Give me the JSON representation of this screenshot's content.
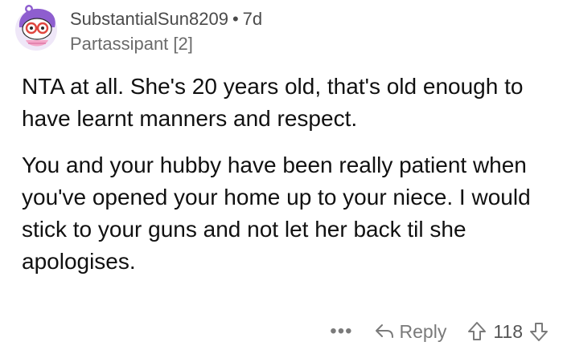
{
  "comment": {
    "author": "SubstantialSun8209",
    "separator": "•",
    "age": "7d",
    "flair": "Partassipant [2]",
    "paragraphs": [
      "NTA at all. She's 20 years old, that's old enough to have learnt manners and respect.",
      "You and your hubby have been really patient when you've opened your home up to your niece. I would stick to your guns and not let her back til she apologises."
    ]
  },
  "actions": {
    "more_label": "•••",
    "reply_label": "Reply",
    "score": "118"
  },
  "icons": {
    "avatar": "snoo-avatar-icon",
    "reply": "reply-arrow-icon",
    "upvote": "upvote-arrow-icon",
    "downvote": "downvote-arrow-icon"
  },
  "colors": {
    "avatar_bg": "#b39dd8",
    "avatar_hair": "#8e5ecf",
    "avatar_glasses": "#e0463f",
    "meta_text": "#6b6b6b"
  }
}
